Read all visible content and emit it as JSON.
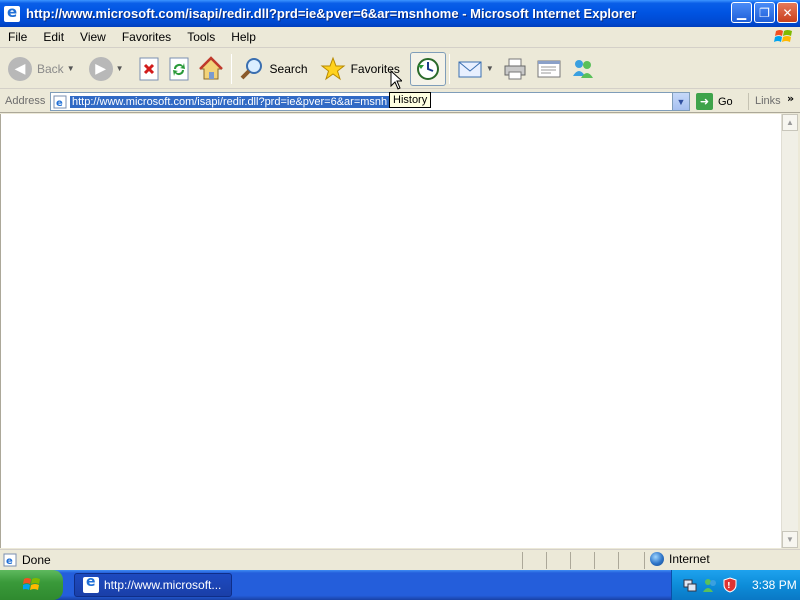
{
  "window": {
    "title": "http://www.microsoft.com/isapi/redir.dll?prd=ie&pver=6&ar=msnhome - Microsoft Internet Explorer",
    "controls": [
      "minimize-icon",
      "maximize-icon",
      "close-icon"
    ]
  },
  "menu": {
    "items": [
      "File",
      "Edit",
      "View",
      "Favorites",
      "Tools",
      "Help"
    ]
  },
  "toolbar": {
    "back_label": "Back",
    "search_label": "Search",
    "favorites_label": "Favorites",
    "history_tooltip": "History"
  },
  "address": {
    "label": "Address",
    "url": "http://www.microsoft.com/isapi/redir.dll?prd=ie&pver=6&ar=msnh",
    "go_label": "Go",
    "links_label": "Links"
  },
  "status": {
    "text": "Done",
    "zone": "Internet"
  },
  "taskbar": {
    "task_label": "http://www.microsoft...",
    "clock": "3:38 PM"
  },
  "colors": {
    "title_blue": "#0054e3",
    "selection": "#316ac5",
    "taskbar_blue": "#245edb",
    "start_green": "#3a9a3a"
  }
}
